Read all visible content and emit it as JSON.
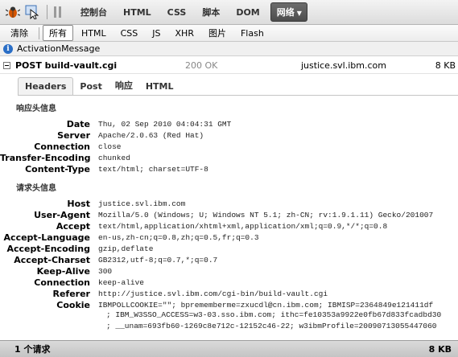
{
  "toolbar": {
    "icons": [
      "firebug-bug-icon",
      "inspect-pointer-icon"
    ],
    "tabs": [
      "控制台",
      "HTML",
      "CSS",
      "脚本",
      "DOM",
      "网络"
    ],
    "active_tab": "网络"
  },
  "filterbar": {
    "clear_label": "清除",
    "filters": [
      "所有",
      "HTML",
      "CSS",
      "JS",
      "XHR",
      "图片",
      "Flash"
    ],
    "active_filter": "所有"
  },
  "activation": {
    "text": "ActivationMessage"
  },
  "request": {
    "method_url": "POST build-vault.cgi",
    "status": "200 OK",
    "domain": "justice.svl.ibm.com",
    "size": "8 KB"
  },
  "detail_tabs": [
    "Headers",
    "Post",
    "响应",
    "HTML"
  ],
  "active_detail_tab": "Headers",
  "response_headers": {
    "title": "响应头信息",
    "rows": [
      {
        "name": "Date",
        "value": "Thu, 02 Sep 2010 04:04:31 GMT"
      },
      {
        "name": "Server",
        "value": "Apache/2.0.63 (Red Hat)"
      },
      {
        "name": "Connection",
        "value": "close"
      },
      {
        "name": "Transfer-Encoding",
        "value": "chunked"
      },
      {
        "name": "Content-Type",
        "value": "text/html; charset=UTF-8"
      }
    ]
  },
  "request_headers": {
    "title": "请求头信息",
    "rows": [
      {
        "name": "Host",
        "value": "justice.svl.ibm.com"
      },
      {
        "name": "User-Agent",
        "value": "Mozilla/5.0 (Windows; U; Windows NT 5.1; zh-CN; rv:1.9.1.11) Gecko/201007"
      },
      {
        "name": "Accept",
        "value": "text/html,application/xhtml+xml,application/xml;q=0.9,*/*;q=0.8"
      },
      {
        "name": "Accept-Language",
        "value": "en-us,zh-cn;q=0.8,zh;q=0.5,fr;q=0.3"
      },
      {
        "name": "Accept-Encoding",
        "value": "gzip,deflate"
      },
      {
        "name": "Accept-Charset",
        "value": "GB2312,utf-8;q=0.7,*;q=0.7"
      },
      {
        "name": "Keep-Alive",
        "value": "300"
      },
      {
        "name": "Connection",
        "value": "keep-alive"
      },
      {
        "name": "Referer",
        "value": "http://justice.svl.ibm.com/cgi-bin/build-vault.cgi"
      },
      {
        "name": "Cookie",
        "value": "IBMPOLLCOOKIE=\"\"; bprememberme=zxucdl@cn.ibm.com; IBMISP=2364849e121411df"
      }
    ],
    "cookie_continuation": [
      "; IBM_W3SSO_ACCESS=w3-03.sso.ibm.com; ithc=fe10353a9922e0fb67d833fcadbd30",
      "; __unam=693fb60-1269c8e712c-12152c46-22; w3ibmProfile=20090713055447060"
    ]
  },
  "footer": {
    "count": "1 个请求",
    "total_size": "8 KB"
  },
  "colors": {
    "active_tab_bg": "#555555",
    "info_icon": "#2a6ec6",
    "status_text": "#888888"
  }
}
